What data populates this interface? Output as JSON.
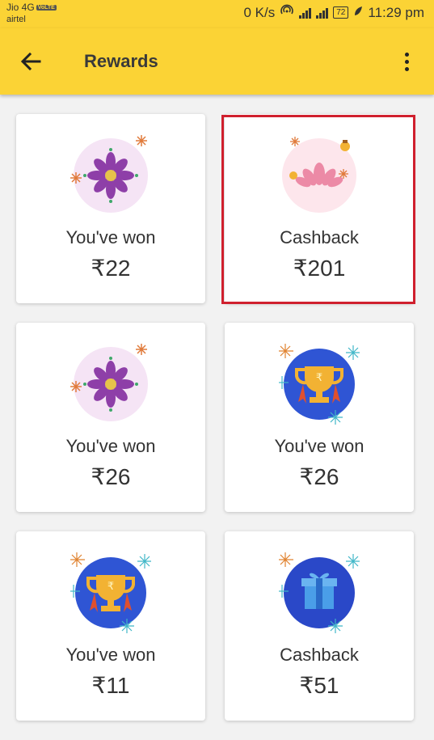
{
  "status_bar": {
    "carrier1": "Jio 4G",
    "volte_badge": "VoLTE",
    "carrier2": "airtel",
    "net_speed": "0 K/s",
    "battery": "72",
    "time": "11:29 pm"
  },
  "app_bar": {
    "title": "Rewards"
  },
  "rewards": [
    {
      "label": "You've won",
      "amount": "₹22"
    },
    {
      "label": "Cashback",
      "amount": "₹201"
    },
    {
      "label": "You've won",
      "amount": "₹26"
    },
    {
      "label": "You've won",
      "amount": "₹26"
    },
    {
      "label": "You've won",
      "amount": "₹11"
    },
    {
      "label": "Cashback",
      "amount": "₹51"
    }
  ],
  "colors": {
    "brand_yellow": "#fbd335",
    "highlight_red": "#d0202e",
    "trophy_blue": "#2f55d4"
  }
}
